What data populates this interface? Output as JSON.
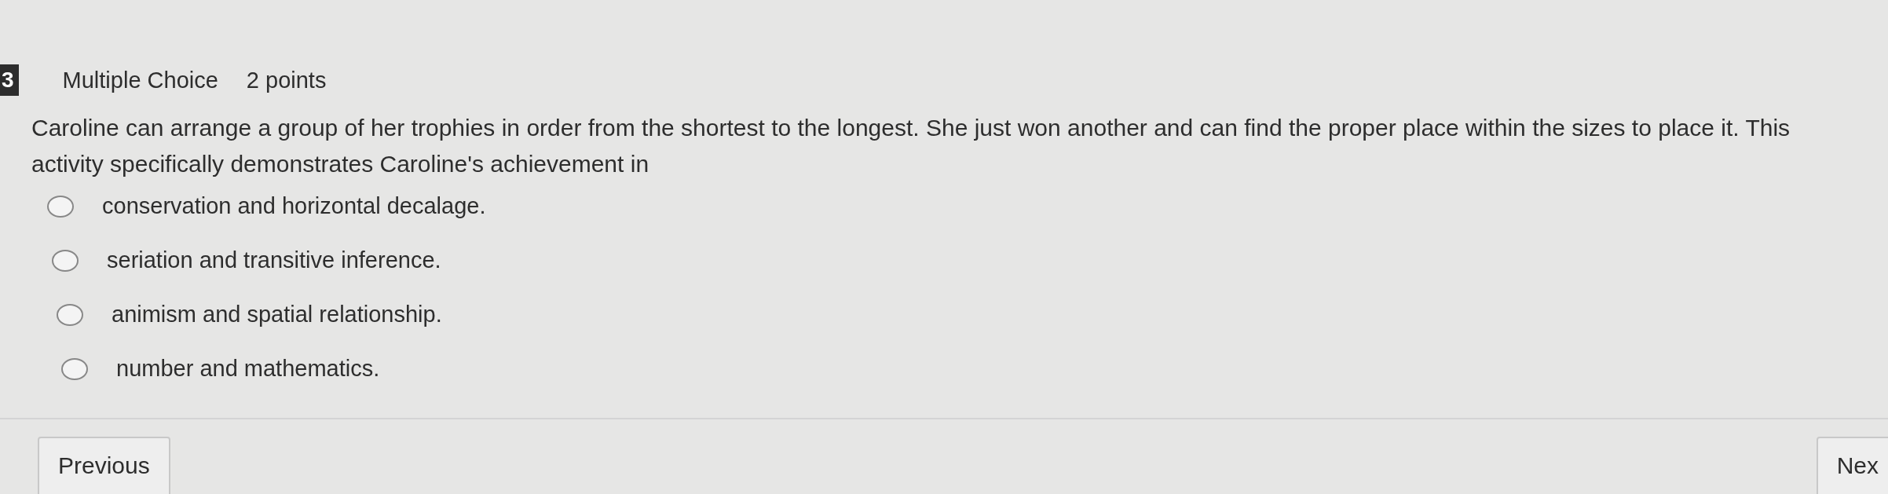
{
  "question": {
    "number": "3",
    "type": "Multiple Choice",
    "points": "2 points",
    "text": "Caroline can arrange a group of her trophies in order from the shortest to the longest.  She just won another and can find the proper place within the sizes to place it. This activity specifically demonstrates Caroline's achievement in"
  },
  "options": [
    {
      "label": "conservation and horizontal decalage.",
      "selected": false
    },
    {
      "label": "seriation and transitive inference.",
      "selected": false
    },
    {
      "label": "animism and spatial relationship.",
      "selected": false
    },
    {
      "label": "number and mathematics.",
      "selected": false
    }
  ],
  "buttons": {
    "previous": "Previous",
    "next": "Nex"
  }
}
